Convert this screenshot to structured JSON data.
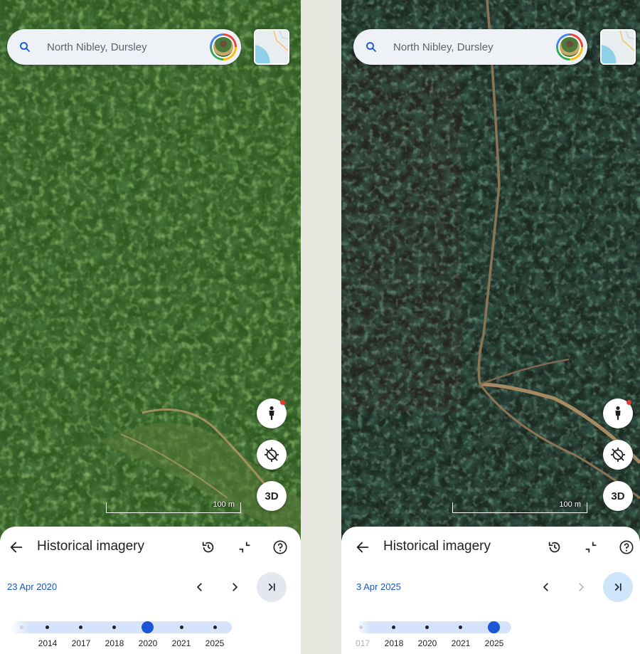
{
  "left": {
    "search": {
      "placeholder": "North Nibley, Dursley"
    },
    "scale_label": "100 m",
    "fab_3d_label": "3D",
    "sheet": {
      "title": "Historical imagery",
      "date": "23 Apr 2020",
      "years": [
        "2014",
        "2017",
        "2018",
        "2020",
        "2021",
        "2025"
      ],
      "selected_year": "2020"
    }
  },
  "right": {
    "search": {
      "placeholder": "North Nibley, Dursley"
    },
    "scale_label": "100 m",
    "fab_3d_label": "3D",
    "sheet": {
      "title": "Historical imagery",
      "date": "3 Apr 2025",
      "years": [
        "017",
        "2018",
        "2020",
        "2021",
        "2025"
      ],
      "selected_year": "2025"
    }
  },
  "icons": {
    "search": "search-icon",
    "layers": "layers-thumbnail-icon",
    "pegman": "pegman-icon",
    "location": "location-off-icon",
    "back": "arrow-back-icon",
    "history": "history-icon",
    "collapse": "collapse-icon",
    "help": "help-icon"
  },
  "colors": {
    "accent": "#1a56d6",
    "date_text": "#1a56c7",
    "timeline_bg": "#d6e4fb"
  }
}
